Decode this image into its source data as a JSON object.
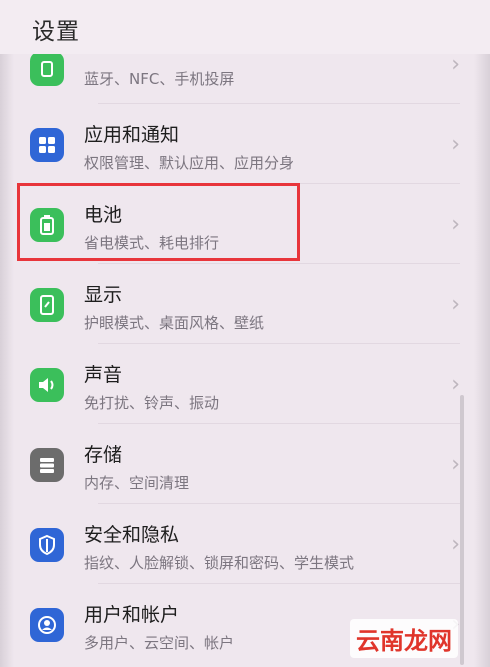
{
  "header": {
    "title": "设置"
  },
  "items": [
    {
      "title": "蓝牙、NFC、手机投屏",
      "subtitle": "",
      "icon": "bluetooth-icon",
      "color": "#3bbf5b"
    },
    {
      "title": "应用和通知",
      "subtitle": "权限管理、默认应用、应用分身",
      "icon": "apps-grid-icon",
      "color": "#2f66d6"
    },
    {
      "title": "电池",
      "subtitle": "省电模式、耗电排行",
      "icon": "battery-icon",
      "color": "#3bbf5b"
    },
    {
      "title": "显示",
      "subtitle": "护眼模式、桌面风格、壁纸",
      "icon": "display-icon",
      "color": "#3bbf5b"
    },
    {
      "title": "声音",
      "subtitle": "免打扰、铃声、振动",
      "icon": "speaker-icon",
      "color": "#3bbf5b"
    },
    {
      "title": "存储",
      "subtitle": "内存、空间清理",
      "icon": "storage-icon",
      "color": "#6c6c6c"
    },
    {
      "title": "安全和隐私",
      "subtitle": "指纹、人脸解锁、锁屏和密码、学生模式",
      "icon": "shield-icon",
      "color": "#2f66d6"
    },
    {
      "title": "用户和帐户",
      "subtitle": "多用户、云空间、帐户",
      "icon": "user-icon",
      "color": "#2f66d6"
    }
  ],
  "watermark": "云南龙网"
}
